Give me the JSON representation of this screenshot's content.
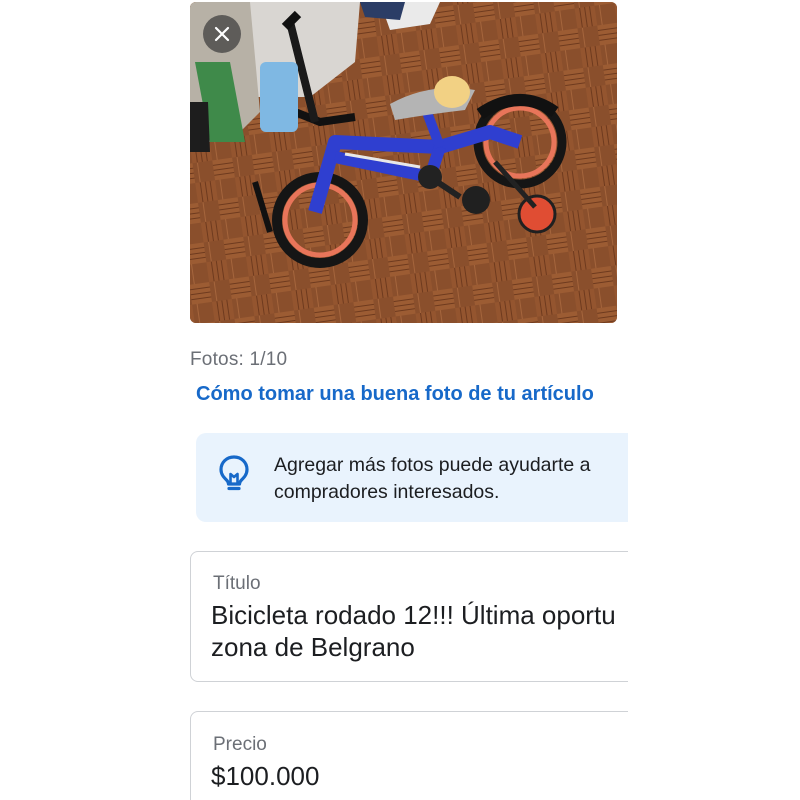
{
  "photo": {
    "close_icon": "close-icon",
    "subject": "bicycle"
  },
  "photos": {
    "count_label": "Fotos: 1/10",
    "tips_link": "Cómo tomar una buena foto de tu artículo"
  },
  "banner": {
    "icon": "lightbulb-icon",
    "text": "Agregar más fotos puede ayudarte a\ncompradores interesados."
  },
  "fields": {
    "title": {
      "label": "Título",
      "value": "Bicicleta rodado 12!!! Última oportu\nzona de Belgrano"
    },
    "price": {
      "label": "Precio",
      "value": "$100.000"
    }
  },
  "colors": {
    "link": "#1769c9",
    "banner_bg": "#e9f3fd",
    "icon_blue": "#1769c9",
    "muted_text": "#6b6f76",
    "field_border": "#cfd2d6"
  }
}
